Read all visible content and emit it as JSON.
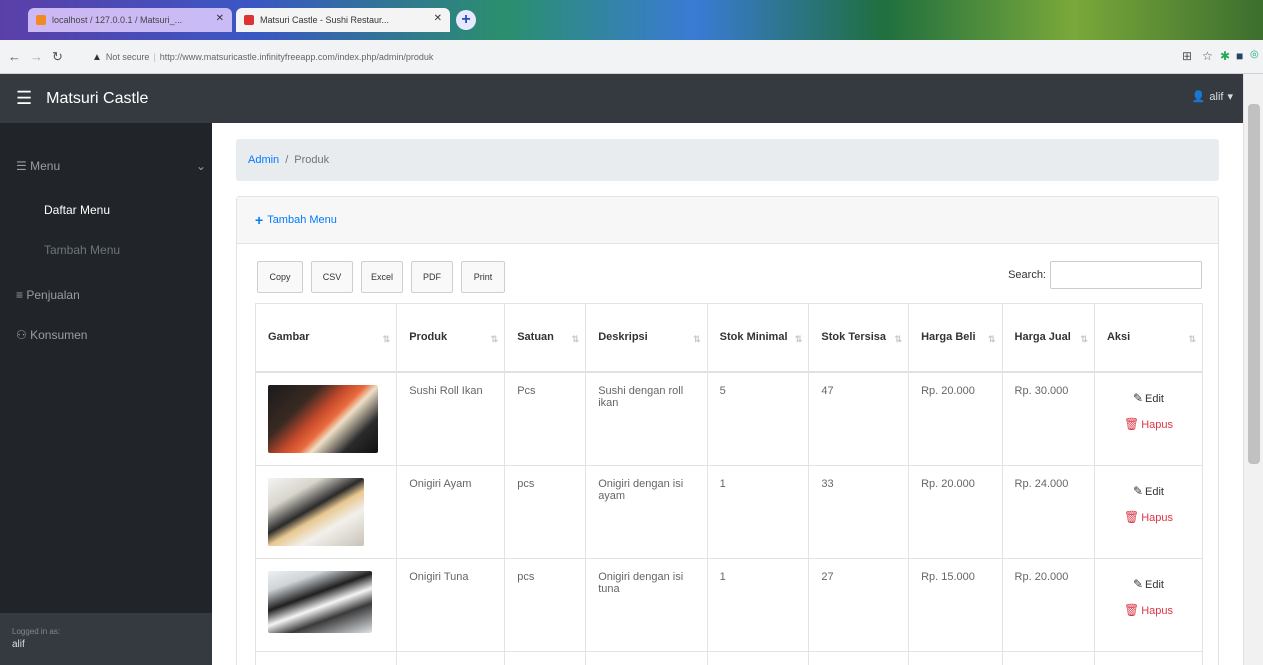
{
  "browser": {
    "tabs": [
      {
        "title": "localhost / 127.0.0.1 / Matsuri_..."
      },
      {
        "title": "Matsuri Castle - Sushi Restaur..."
      }
    ],
    "security": "Not secure",
    "url": "http://www.matsuricastle.infinityfreeapp.com/index.php/admin/produk"
  },
  "navbar": {
    "brand": "Matsuri Castle",
    "user": "alif"
  },
  "sidebar": {
    "menu_label": "Menu",
    "items": [
      "Daftar Menu",
      "Tambah Menu"
    ],
    "penjualan": "Penjualan",
    "konsumen": "Konsumen",
    "footer_label": "Logged in as:",
    "footer_user": "alif"
  },
  "breadcrumb": {
    "root": "Admin",
    "current": "Produk"
  },
  "card": {
    "add_label": "Tambah Menu"
  },
  "dt_buttons": [
    "Copy",
    "CSV",
    "Excel",
    "PDF",
    "Print"
  ],
  "search": {
    "label": "Search:",
    "value": ""
  },
  "table": {
    "headers": [
      "Gambar",
      "Produk",
      "Satuan",
      "Deskripsi",
      "Stok Minimal",
      "Stok Tersisa",
      "Harga Beli",
      "Harga Jual",
      "Aksi"
    ],
    "rows": [
      {
        "produk": "Sushi Roll Ikan",
        "satuan": "Pcs",
        "deskripsi": "Sushi dengan roll ikan",
        "stok_minimal": "5",
        "stok_tersisa": "47",
        "harga_beli": "Rp. 20.000",
        "harga_jual": "Rp. 30.000"
      },
      {
        "produk": "Onigiri Ayam",
        "satuan": "pcs",
        "deskripsi": "Onigiri dengan isi ayam",
        "stok_minimal": "1",
        "stok_tersisa": "33",
        "harga_beli": "Rp. 20.000",
        "harga_jual": "Rp. 24.000"
      },
      {
        "produk": "Onigiri Tuna",
        "satuan": "pcs",
        "deskripsi": "Onigiri dengan isi tuna",
        "stok_minimal": "1",
        "stok_tersisa": "27",
        "harga_beli": "Rp. 15.000",
        "harga_jual": "Rp. 20.000"
      }
    ],
    "edit_label": "Edit",
    "hapus_label": "Hapus"
  },
  "colors": {
    "navbar": "#343a40",
    "sidebar": "#212529",
    "link": "#007bff",
    "danger": "#dc3545"
  }
}
